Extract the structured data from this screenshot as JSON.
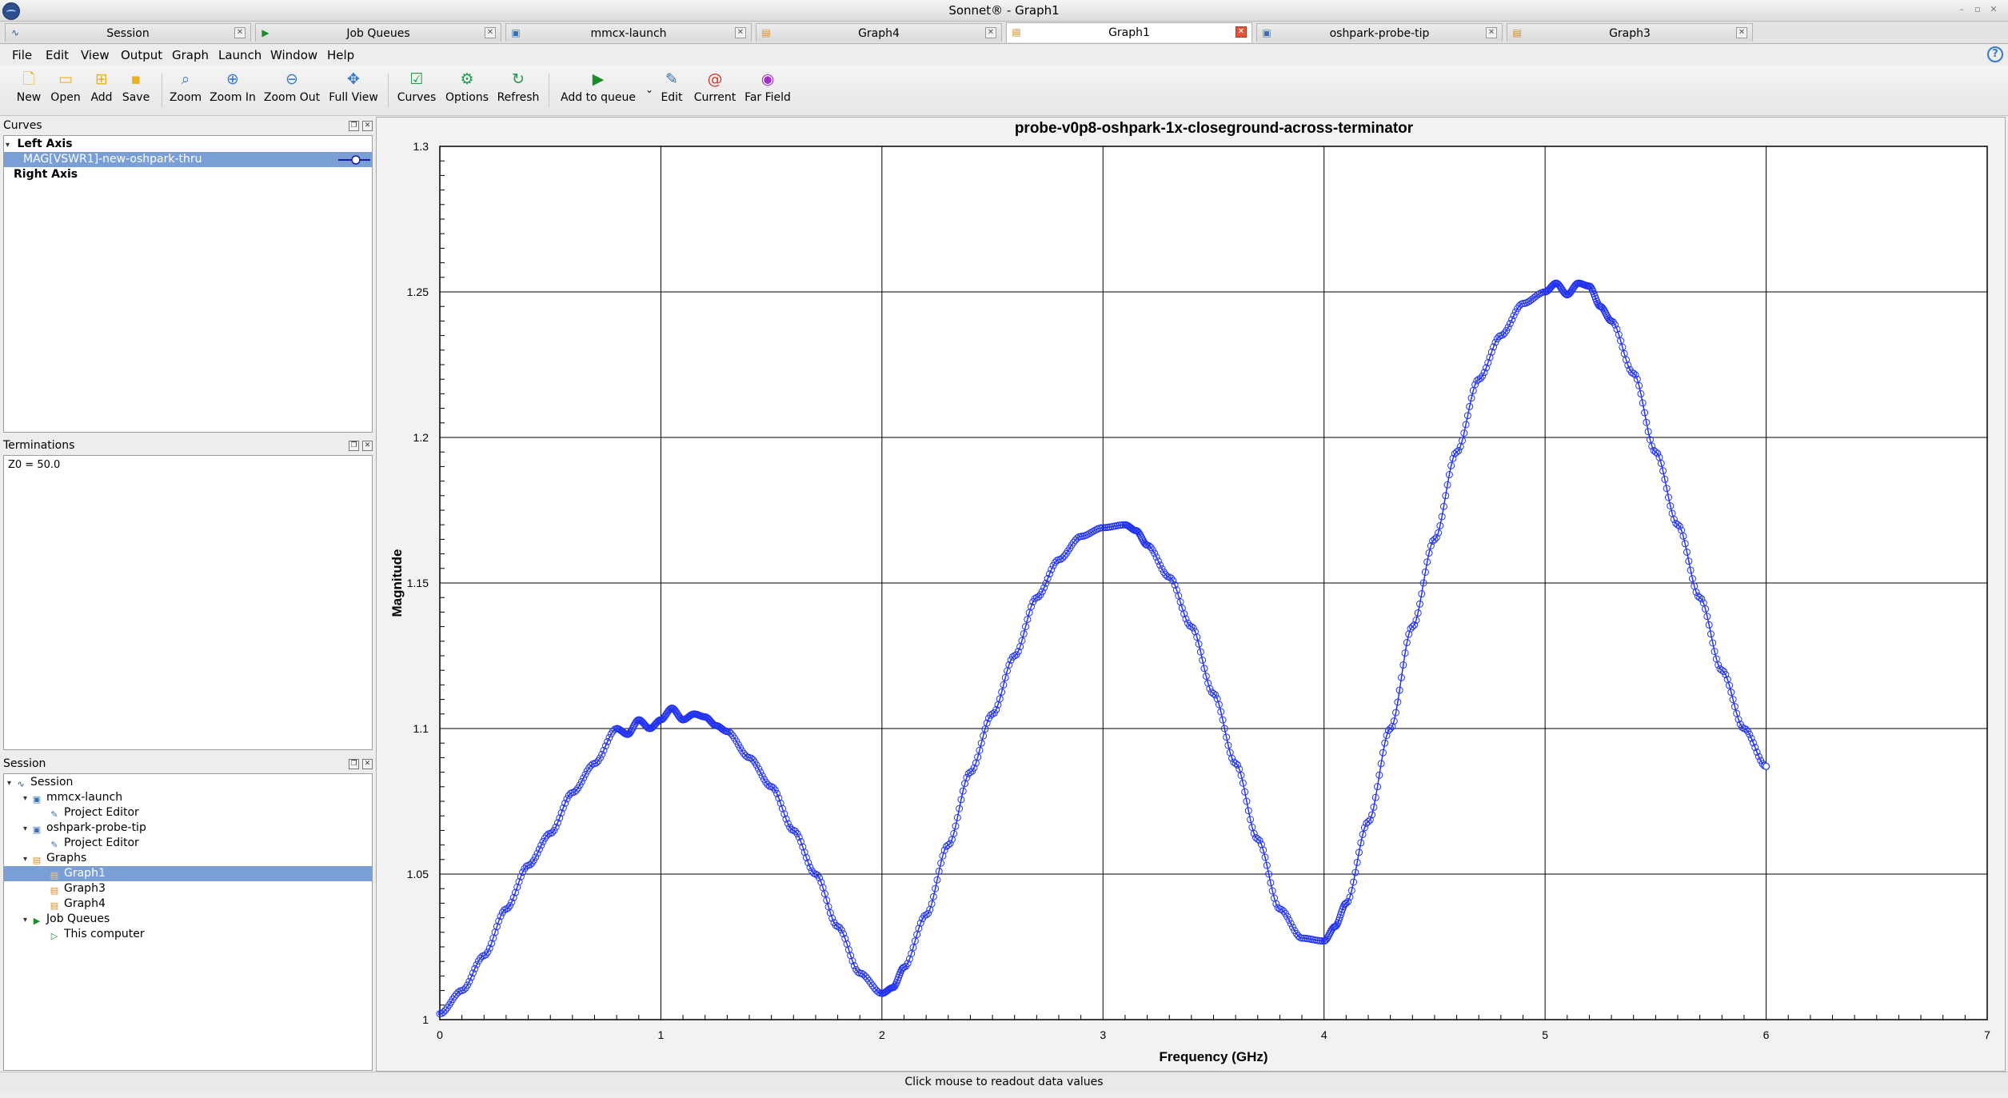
{
  "window": {
    "title": "Sonnet® - Graph1"
  },
  "tabs": [
    {
      "label": "Session",
      "icon": "session-icon",
      "active": false
    },
    {
      "label": "Job Queues",
      "icon": "em-queue-icon",
      "active": false
    },
    {
      "label": "mmcx-launch",
      "icon": "project-icon",
      "active": false
    },
    {
      "label": "Graph4",
      "icon": "graph-icon",
      "active": false
    },
    {
      "label": "Graph1",
      "icon": "graph-icon",
      "active": true
    },
    {
      "label": "oshpark-probe-tip",
      "icon": "project-icon",
      "active": false
    },
    {
      "label": "Graph3",
      "icon": "graph-icon",
      "active": false
    }
  ],
  "menu": [
    "File",
    "Edit",
    "View",
    "Output",
    "Graph",
    "Launch",
    "Window",
    "Help"
  ],
  "toolbar": {
    "new": "New",
    "open": "Open",
    "add": "Add",
    "save": "Save",
    "zoom": "Zoom",
    "zoom_in": "Zoom In",
    "zoom_out": "Zoom Out",
    "full_view": "Full View",
    "curves": "Curves",
    "options": "Options",
    "refresh": "Refresh",
    "add_to_queue": "Add to queue",
    "edit": "Edit",
    "current": "Current",
    "far_field": "Far Field"
  },
  "curves_panel": {
    "title": "Curves",
    "left_axis": "Left Axis",
    "curve_label": "MAG[VSWR1]-new-oshpark-thru",
    "right_axis": "Right Axis"
  },
  "terminations_panel": {
    "title": "Terminations",
    "text": "Z0 = 50.0"
  },
  "session_panel": {
    "title": "Session",
    "items": [
      {
        "label": "Session"
      },
      {
        "label": "mmcx-launch"
      },
      {
        "label": "Project Editor"
      },
      {
        "label": "oshpark-probe-tip"
      },
      {
        "label": "Project Editor"
      },
      {
        "label": "Graphs"
      },
      {
        "label": "Graph1",
        "selected": true
      },
      {
        "label": "Graph3"
      },
      {
        "label": "Graph4"
      },
      {
        "label": "Job Queues"
      },
      {
        "label": "This computer"
      }
    ]
  },
  "status": {
    "text": "Click mouse to readout data values"
  },
  "colors": {
    "curve": "#2233ee",
    "selection": "#7a9fd6",
    "active_close": "#e0523a"
  },
  "chart_data": {
    "type": "line",
    "title": "probe-v0p8-oshpark-1x-closeground-across-terminator",
    "xlabel": "Frequency (GHz)",
    "ylabel": "Magnitude",
    "xlim": [
      0,
      7
    ],
    "ylim": [
      1,
      1.3
    ],
    "xticks": [
      0,
      1,
      2,
      3,
      4,
      5,
      6,
      7
    ],
    "yticks": [
      "1",
      "1.05",
      "1.1",
      "1.15",
      "1.2",
      "1.25",
      "1.3"
    ],
    "grid": true,
    "series": [
      {
        "name": "MAG[VSWR1]-new-oshpark-thru",
        "marker": "circle",
        "x": [
          0,
          0.1,
          0.2,
          0.3,
          0.4,
          0.5,
          0.6,
          0.7,
          0.8,
          0.85,
          0.9,
          0.95,
          1.0,
          1.05,
          1.1,
          1.15,
          1.2,
          1.25,
          1.3,
          1.4,
          1.5,
          1.6,
          1.7,
          1.8,
          1.9,
          2.0,
          2.05,
          2.1,
          2.2,
          2.3,
          2.4,
          2.5,
          2.6,
          2.7,
          2.8,
          2.9,
          3.0,
          3.1,
          3.15,
          3.2,
          3.3,
          3.4,
          3.5,
          3.6,
          3.7,
          3.8,
          3.9,
          4.0,
          4.05,
          4.1,
          4.2,
          4.3,
          4.4,
          4.5,
          4.6,
          4.7,
          4.8,
          4.9,
          5.0,
          5.05,
          5.1,
          5.15,
          5.2,
          5.25,
          5.3,
          5.4,
          5.5,
          5.6,
          5.7,
          5.8,
          5.9,
          6.0
        ],
        "y": [
          1.002,
          1.01,
          1.022,
          1.038,
          1.053,
          1.064,
          1.078,
          1.088,
          1.1,
          1.098,
          1.103,
          1.1,
          1.103,
          1.107,
          1.103,
          1.105,
          1.104,
          1.101,
          1.099,
          1.09,
          1.08,
          1.065,
          1.05,
          1.032,
          1.016,
          1.009,
          1.011,
          1.018,
          1.036,
          1.06,
          1.085,
          1.105,
          1.125,
          1.145,
          1.158,
          1.166,
          1.169,
          1.17,
          1.168,
          1.163,
          1.152,
          1.135,
          1.112,
          1.088,
          1.062,
          1.038,
          1.028,
          1.027,
          1.032,
          1.04,
          1.068,
          1.1,
          1.135,
          1.165,
          1.195,
          1.22,
          1.235,
          1.246,
          1.25,
          1.253,
          1.249,
          1.253,
          1.252,
          1.245,
          1.24,
          1.222,
          1.195,
          1.17,
          1.145,
          1.12,
          1.1,
          1.087
        ]
      }
    ]
  }
}
